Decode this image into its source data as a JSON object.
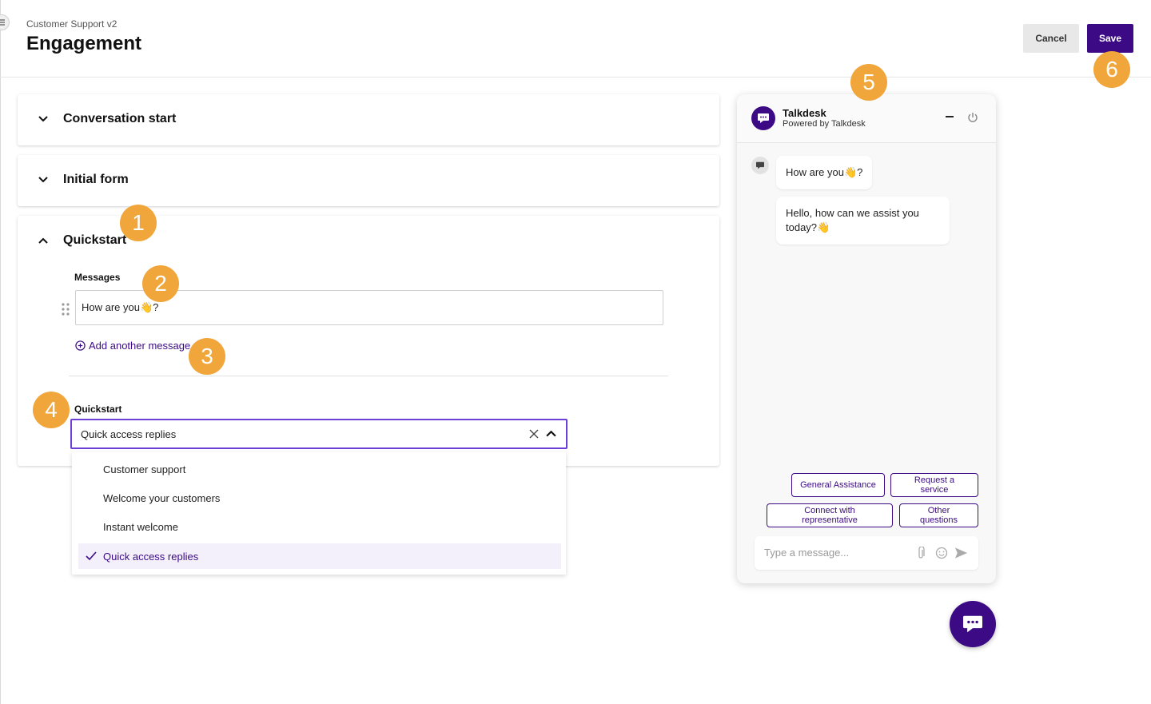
{
  "header": {
    "breadcrumb": "Customer Support v2",
    "title": "Engagement",
    "cancel_label": "Cancel",
    "save_label": "Save"
  },
  "sections": [
    {
      "title": "Conversation start",
      "expanded": false
    },
    {
      "title": "Initial form",
      "expanded": false
    },
    {
      "title": "Quickstart",
      "expanded": true
    }
  ],
  "quickstart_section": {
    "messages_label": "Messages",
    "messages": [
      "How are you👋?"
    ],
    "add_message_label": "Add another message",
    "quickstart_label": "Quickstart",
    "selected_value": "Quick access replies",
    "options": [
      "Customer support",
      "Welcome your customers",
      "Instant welcome",
      "Quick access replies"
    ]
  },
  "badges": [
    "1",
    "2",
    "3",
    "4",
    "5",
    "6"
  ],
  "preview": {
    "brand_name": "Talkdesk",
    "powered_by": "Powered by Talkdesk",
    "bubbles": [
      "How are you👋?",
      "Hello, how can we assist you today?👋"
    ],
    "quick_replies": [
      "General Assistance",
      "Request a service",
      "Connect with representative",
      "Other questions"
    ],
    "input_placeholder": "Type a message..."
  },
  "colors": {
    "brand": "#3b0a84",
    "badge": "#f0a63a",
    "focus": "#6c3fd6",
    "selected_bg": "#f3f0fb"
  }
}
